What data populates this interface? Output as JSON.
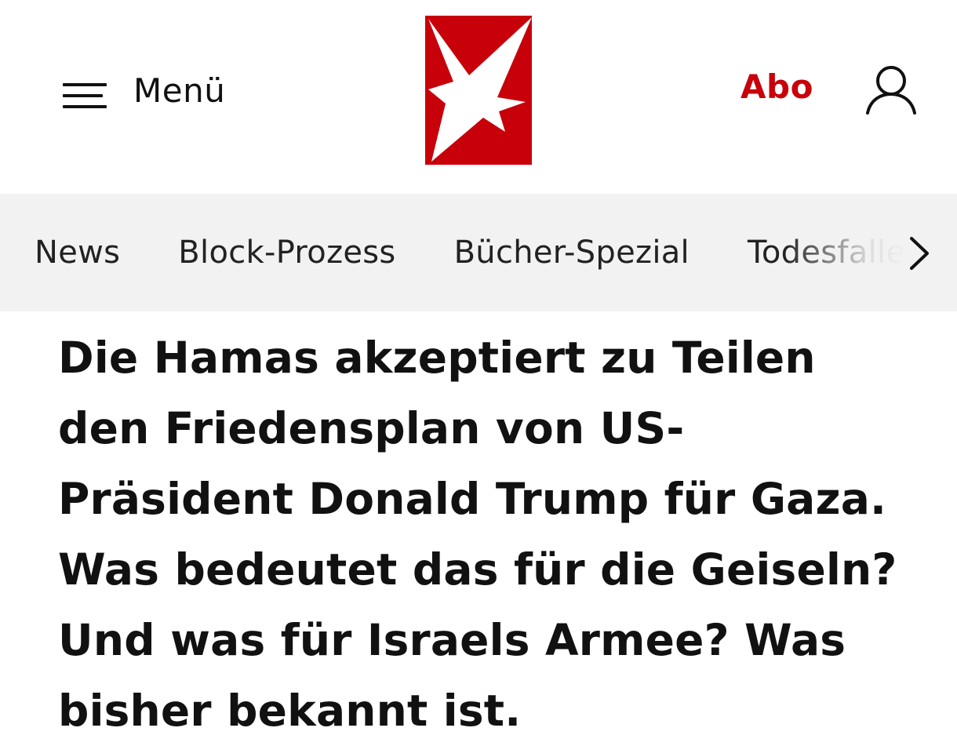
{
  "header": {
    "menu_label": "Menü",
    "menu_icon": "hamburger-menu-icon",
    "logo": "stern-logo",
    "abo_label": "Abo",
    "account_icon": "user-account-icon",
    "brand_color": "#c8000a"
  },
  "nav": {
    "items": [
      {
        "label": "News"
      },
      {
        "label": "Block-Prozess"
      },
      {
        "label": "Bücher-Spezial"
      },
      {
        "label": "Todesfalle"
      }
    ],
    "next_icon": "chevron-right-icon",
    "background": "#f2f2f2"
  },
  "article": {
    "teaser": "Die Hamas akzeptiert zu Teilen den Friedensplan von US-Präsident Donald Trump für Gaza. Was bedeutet das für die Geiseln? Und was für Israels Armee? Was bisher bekannt ist."
  }
}
